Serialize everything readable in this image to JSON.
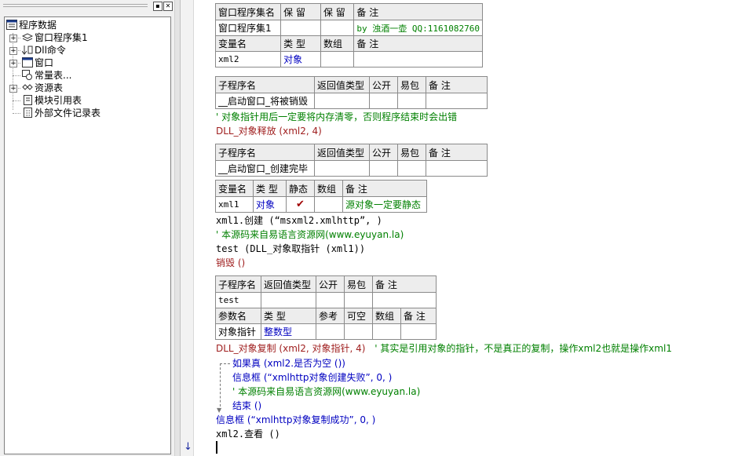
{
  "tree": {
    "buttons": {
      "minimize": "▪",
      "close": "✕"
    },
    "root": "程序数据",
    "items": [
      {
        "label": "窗口程序集1",
        "icon": "assembly-icon",
        "expandable": true
      },
      {
        "label": "Dll命令",
        "icon": "dll-command-icon",
        "expandable": true
      },
      {
        "label": "窗口",
        "icon": "window-icon",
        "expandable": true
      },
      {
        "label": "常量表...",
        "icon": "constant-table-icon",
        "expandable": false
      },
      {
        "label": "资源表",
        "icon": "resource-table-icon",
        "expandable": true
      },
      {
        "label": "模块引用表",
        "icon": "module-reference-icon",
        "expandable": false
      },
      {
        "label": "外部文件记录表",
        "icon": "external-file-icon",
        "expandable": false
      }
    ]
  },
  "code": {
    "assembly_table": {
      "headers": [
        "窗口程序集名",
        "保 留",
        "保 留",
        "备 注"
      ],
      "row": [
        "窗口程序集1",
        "",
        "",
        "by 浊酒一壶 QQ:1161082760"
      ],
      "var_headers": [
        "变量名",
        "类 型",
        "数组",
        "备 注"
      ],
      "var_row": [
        "xml2",
        "对象",
        "",
        ""
      ]
    },
    "sub1_table": {
      "headers": [
        "子程序名",
        "返回值类型",
        "公开",
        "易包",
        "备 注"
      ],
      "row": [
        "__启动窗口_将被销毁",
        "",
        "",
        "",
        ""
      ]
    },
    "comment1": "' 对象指针用后一定要将内存清零，否则程序结束时会出错",
    "line_release": "DLL_对象释放 (xml2, 4)",
    "sub2_table": {
      "headers": [
        "子程序名",
        "返回值类型",
        "公开",
        "易包",
        "备 注"
      ],
      "row": [
        "__启动窗口_创建完毕",
        "",
        "",
        "",
        ""
      ]
    },
    "local_var_table": {
      "headers": [
        "变量名",
        "类 型",
        "静态",
        "数组",
        "备 注"
      ],
      "row": [
        "xml1",
        "对象",
        "✔",
        "",
        "源对象一定要静态"
      ]
    },
    "line_create": "xml1.创建 (“msxml2.xmlhttp”, )",
    "comment2": "' 本源码来自易语言资源网(www.eyuyan.la)",
    "line_test": "test (DLL_对象取指针 (xml1))",
    "line_destroy": "销毁 ()",
    "sub3_table": {
      "headers": [
        "子程序名",
        "返回值类型",
        "公开",
        "易包",
        "备 注"
      ],
      "row": [
        "test",
        "",
        "",
        "",
        ""
      ],
      "param_headers": [
        "参数名",
        "类 型",
        "参考",
        "可空",
        "数组",
        "备 注"
      ],
      "param_row": [
        "对象指针",
        "整数型",
        "",
        "",
        "",
        ""
      ]
    },
    "line_copy": "DLL_对象复制 (xml2, 对象指针, 4)",
    "comment3": "' 其实是引用对象的指针，不是真正的复制，操作xml2也就是操作xml1",
    "line_if": "如果真 (xml2.是否为空 ())",
    "line_msg_fail": "信息框 (“xmlhttp对象创建失败”, 0, )",
    "comment4": "' 本源码来自易语言资源网(www.eyuyan.la)",
    "line_end": "结束 ()",
    "line_msg_ok": "信息框 (“xmlhttp对象复制成功”, 0, )",
    "line_view": "xml2.查看 ()"
  }
}
